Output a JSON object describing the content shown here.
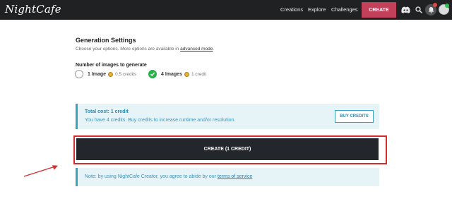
{
  "nav": {
    "logo": "NightCafe",
    "links": [
      "Creations",
      "Explore",
      "Challenges"
    ],
    "create_label": "CREATE"
  },
  "settings": {
    "title": "Generation Settings",
    "subtitle_prefix": "Choose your options. More options are available in ",
    "subtitle_link": "advanced mode",
    "subtitle_suffix": ".",
    "num_images_label": "Number of images to generate",
    "options": [
      {
        "label": "1 Image",
        "cost": "0.5 credits",
        "selected": false
      },
      {
        "label": "4 Images",
        "cost": "1 credit",
        "selected": true
      }
    ]
  },
  "cost": {
    "title": "Total cost: 1 credit",
    "text": "You have 4 credits. Buy credits to increase runtime and/or resolution.",
    "buy_label": "BUY CREDITS"
  },
  "create_button": {
    "label": "CREATE (1 CREDIT)"
  },
  "note": {
    "prefix": "Note: by using NightCafe Creator, you agree to abide by our ",
    "link": "terms of service"
  },
  "colors": {
    "topbar": "#1f2123",
    "accent": "#c2405a",
    "info_bg": "#e6f3f7",
    "info_text": "#3a95b8",
    "highlight": "#d62b2b",
    "selected": "#2ab04a"
  }
}
